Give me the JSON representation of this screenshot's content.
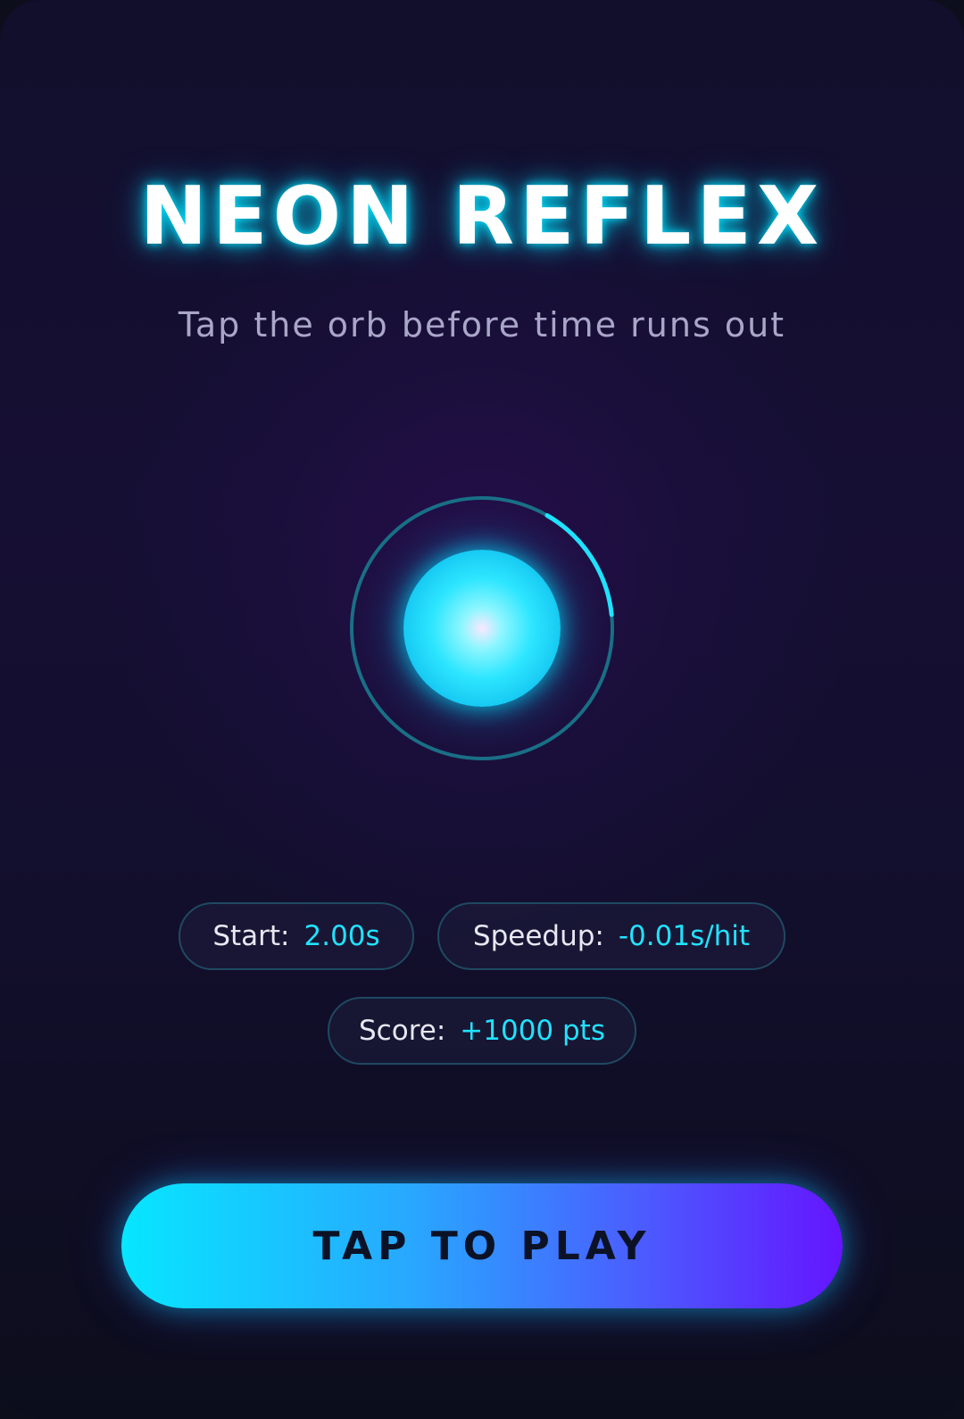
{
  "game": {
    "title": "NEON REFLEX",
    "subtitle": "Tap the orb before time runs out"
  },
  "orb": {
    "timer_remaining_fraction": 0.15,
    "colors": {
      "ring_track": "#1a6f86",
      "ring_progress": "#1fe3ff",
      "orb_core": "#2ee6ff"
    }
  },
  "stats": {
    "start": {
      "label": "Start:",
      "value": "2.00s"
    },
    "speedup": {
      "label": "Speedup:",
      "value": "-0.01s/hit"
    },
    "score": {
      "label": "Score:",
      "value": "+1000 pts"
    }
  },
  "play_button": {
    "label": "TAP TO PLAY"
  },
  "colors": {
    "accent": "#21e2ff",
    "button_start": "#07e6ff",
    "button_end": "#6415ff"
  }
}
